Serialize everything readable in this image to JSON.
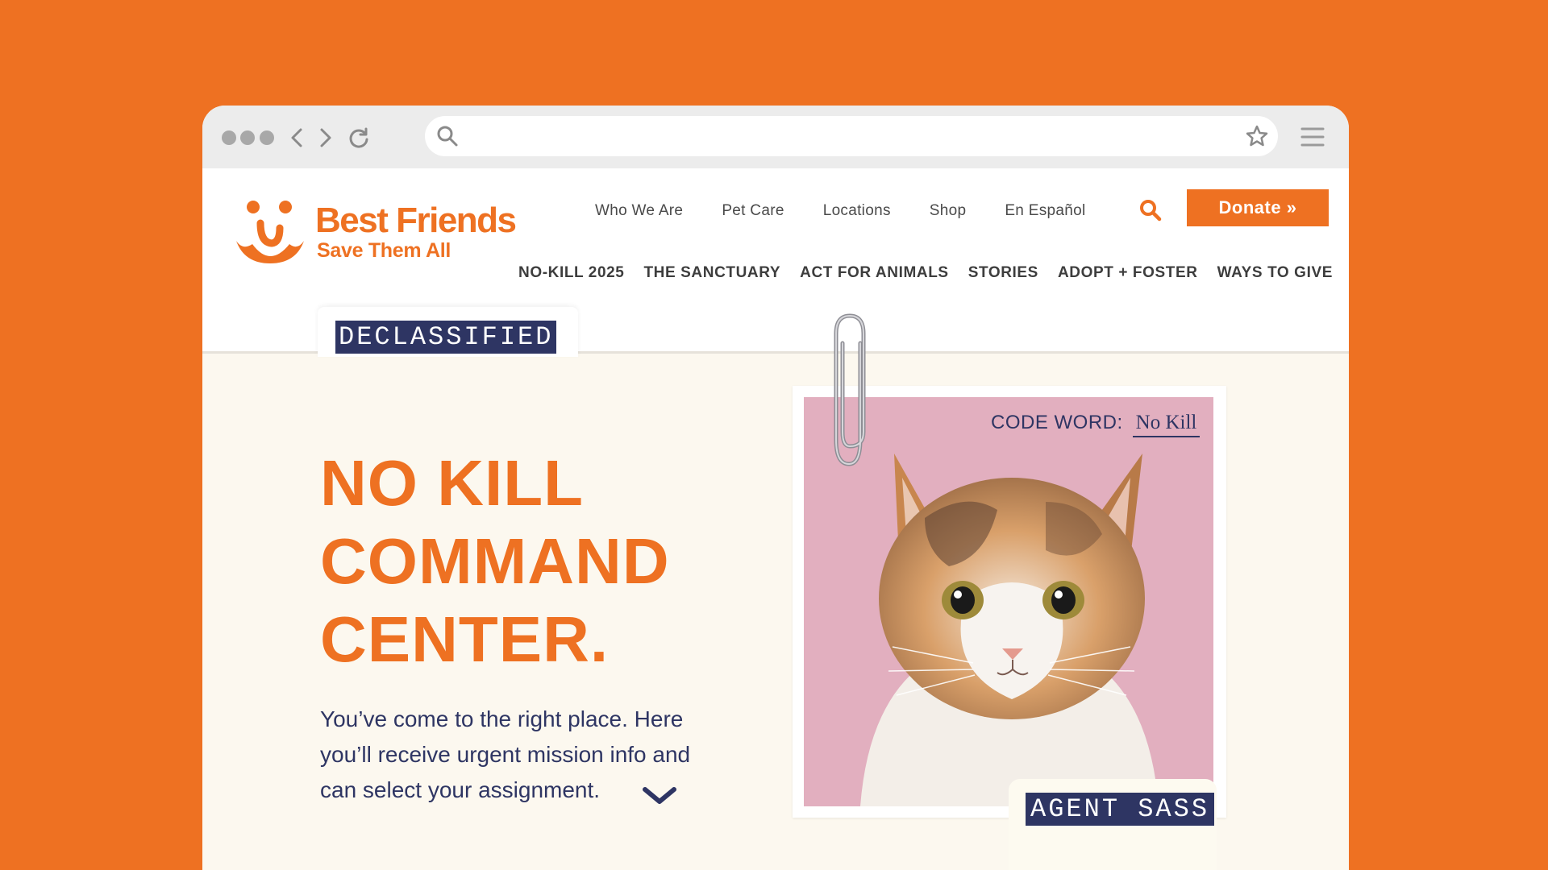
{
  "browser": {
    "icons": {
      "window_dots": "window-dots",
      "back": "chevron-left-icon",
      "forward": "chevron-right-icon",
      "reload": "reload-icon",
      "search": "search-icon",
      "bookmark": "star-icon",
      "menu": "hamburger-menu-icon"
    },
    "address_value": ""
  },
  "header": {
    "logo_title": "Best Friends",
    "logo_tag": "Save Them All",
    "utility_nav": [
      "Who We Are",
      "Pet Care",
      "Locations",
      "Shop",
      "En Español"
    ],
    "donate_label": "Donate »",
    "main_nav": [
      "NO-KILL 2025",
      "THE SANCTUARY",
      "ACT FOR ANIMALS",
      "STORIES",
      "ADOPT + FOSTER",
      "WAYS TO GIVE"
    ]
  },
  "hero": {
    "tab_stamp": "DECLASSIFIED",
    "title_lines": [
      "NO KILL",
      "COMMAND",
      "CENTER."
    ],
    "body": "You’ve come to the right place. Here you’ll receive urgent mission info and can select your assignment.",
    "code_word_label": "CODE WORD:",
    "code_word_value": "No Kill",
    "agent_stamp": "AGENT SASS"
  },
  "colors": {
    "brand_orange": "#EE7122",
    "navy": "#2E3563",
    "hero_bg": "#FCF8EF",
    "photo_bg": "#E2AFBF"
  }
}
